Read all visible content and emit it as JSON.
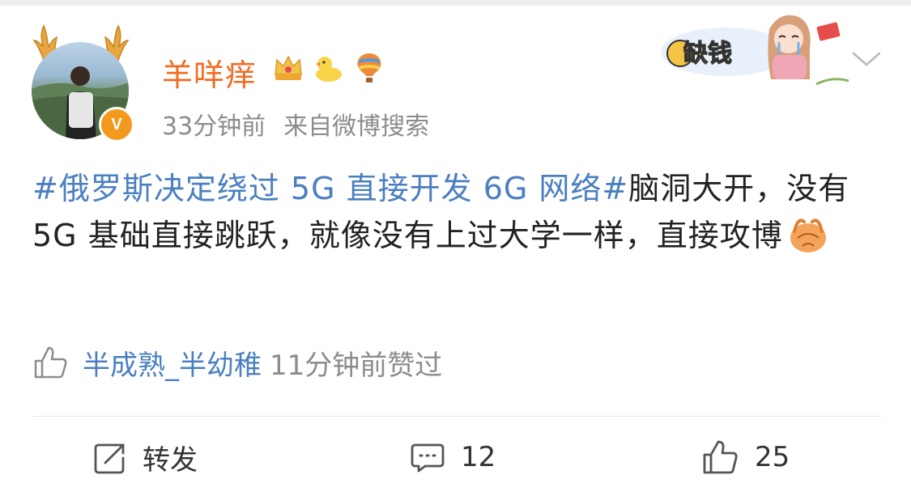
{
  "post": {
    "author": "羊咩痒",
    "badges": [
      "vip-crown-badge",
      "duck-badge",
      "hot-air-balloon-badge"
    ],
    "time": "33分钟前",
    "source": "来自微博搜索",
    "hashtag": "#俄罗斯决定绕过 5G 直接开发 6G 网络#",
    "text": "脑洞大开，没有 5G 基础直接跳跃，就像没有上过大学一样，直接攻博",
    "emoji": "clapping-hands-emoji",
    "decoration_text": "缺钱"
  },
  "liked_by": {
    "user": "半成熟_半幼稚",
    "text": "11分钟前赞过"
  },
  "actions": {
    "repost_label": "转发",
    "comment_count": "12",
    "like_count": "25"
  },
  "colors": {
    "username": "#f26c23",
    "link": "#4a7fc0",
    "meta": "#8c8c8c",
    "body": "#222222"
  }
}
